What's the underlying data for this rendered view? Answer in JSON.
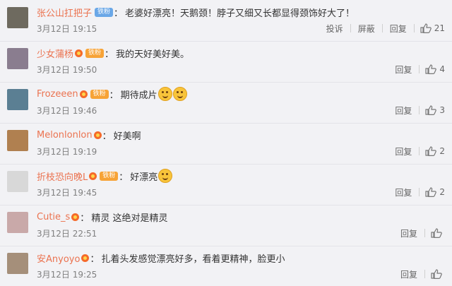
{
  "comments": [
    {
      "user": "张公山扛把子",
      "badge": {
        "type": "blue",
        "text": "铁粉"
      },
      "has_crown": false,
      "text": "老婆好漂亮！天鹅颈！脖子又细又长都显得颈饰好大了！",
      "emoji": 0,
      "time": "3月12日 19:15",
      "actions": [
        "投诉",
        "屏蔽",
        "回复"
      ],
      "likes": "21",
      "avatar_color": "#6e6a5f"
    },
    {
      "user": "少女蒲杨",
      "badge": {
        "type": "orange",
        "text": "铁粉"
      },
      "has_crown": true,
      "text": "我的天好美好美。",
      "emoji": 0,
      "time": "3月12日 19:50",
      "actions": [
        "回复"
      ],
      "likes": "4",
      "avatar_color": "#8a7d8f"
    },
    {
      "user": "Frozeeen",
      "badge": {
        "type": "orange",
        "text": "铁粉"
      },
      "has_crown": true,
      "text": "期待成片",
      "emoji": 2,
      "time": "3月12日 19:46",
      "actions": [
        "回复"
      ],
      "likes": "3",
      "avatar_color": "#5b7f93"
    },
    {
      "user": "Melonlonlon",
      "badge": null,
      "has_crown": true,
      "text": "好美啊",
      "emoji": 0,
      "time": "3月12日 19:19",
      "actions": [
        "回复"
      ],
      "likes": "2",
      "avatar_color": "#b08050"
    },
    {
      "user": "折枝恐向晚L",
      "badge": {
        "type": "orange",
        "text": "铁粉"
      },
      "has_crown": true,
      "text": "好漂亮",
      "emoji": 1,
      "time": "3月12日 19:45",
      "actions": [
        "回复"
      ],
      "likes": "2",
      "avatar_color": "#d8d8d8"
    },
    {
      "user": "Cutie_s",
      "badge": null,
      "has_crown": true,
      "text": "精灵 这绝对是精灵",
      "emoji": 0,
      "time": "3月12日 22:51",
      "actions": [
        "回复"
      ],
      "likes": "",
      "avatar_color": "#c9a9a9"
    },
    {
      "user": "安Anyoyo",
      "badge": null,
      "has_crown": true,
      "text": "扎着头发感觉漂亮好多，看着更精神，脸更小",
      "emoji": 0,
      "time": "3月12日 19:25",
      "actions": [
        "回复"
      ],
      "likes": "",
      "avatar_color": "#a58f7a"
    }
  ]
}
